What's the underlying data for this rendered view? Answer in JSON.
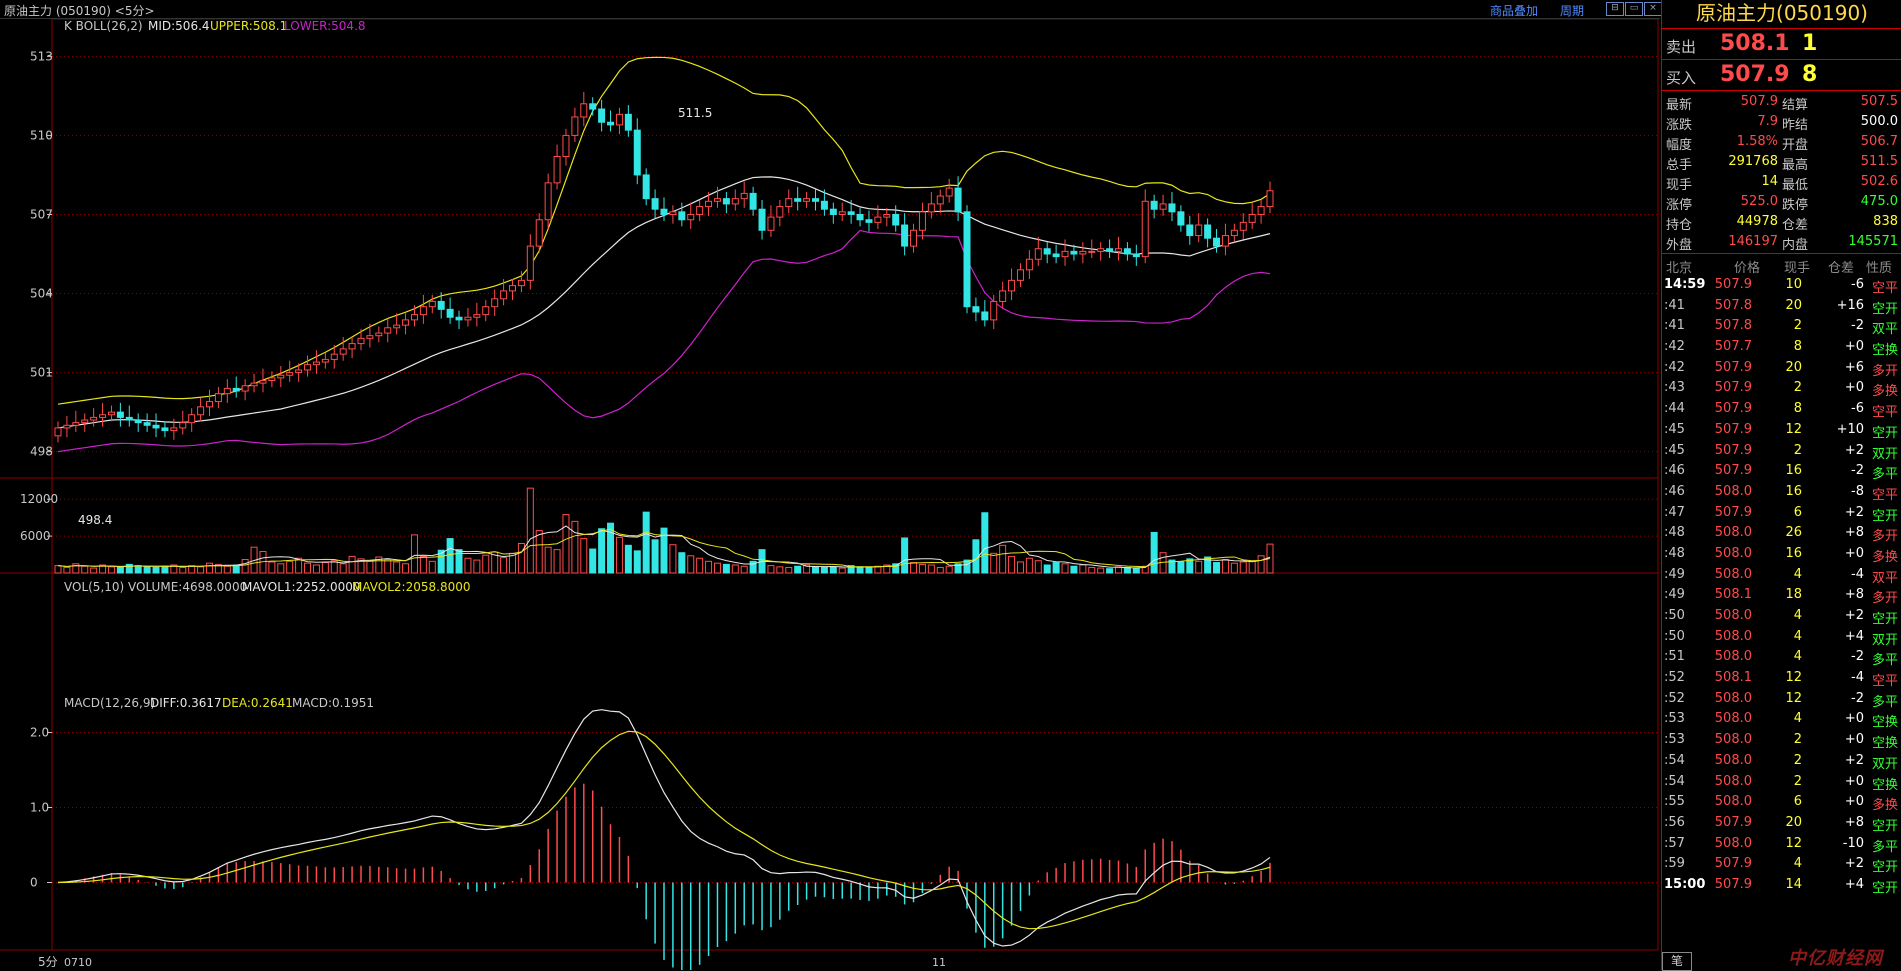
{
  "window": {
    "title": "原油主力 (050190) <5分>",
    "links": [
      "商品叠加",
      "周期"
    ]
  },
  "main_chart": {
    "indicator_label": "K  BOLL(26,2)",
    "mid_label": "MID:506.4",
    "upper_label": "UPPER:508.1",
    "lower_label": "LOWER:504.8",
    "y_ticks": [
      "513",
      "510",
      "507",
      "504",
      "501",
      "498"
    ],
    "high_marker": "511.5",
    "low_marker": "498.4"
  },
  "volume_chart": {
    "vol_label": "VOL(5,10) VOLUME:4698.0000",
    "mavol1_label": "MAVOL1:2252.0000",
    "mavol2_label": "MAVOL2:2058.8000",
    "y_ticks": [
      "12000",
      "6000"
    ]
  },
  "macd_chart": {
    "macd_label": "MACD(12,26,9)",
    "diff_label": "DIFF:0.3617",
    "dea_label": "DEA:0.2641",
    "macd_value_label": "MACD:0.1951",
    "y_ticks": [
      "2.0",
      "1.0",
      "0"
    ]
  },
  "x_axis": {
    "period_label": "5分",
    "labels": [
      "0710",
      "11"
    ]
  },
  "colors": {
    "up": "#ff4b4b",
    "down": "#33e6e6",
    "mid": "#e6e6e6",
    "upper": "#e6e61a",
    "lower": "#cc22cc",
    "grid": "#8b0000"
  },
  "chart_data": [
    {
      "type": "candlestick",
      "title": "",
      "indicators": [
        "BOLL(26,2)"
      ],
      "ylim": [
        497,
        514
      ],
      "x_labels": [
        "0710",
        "11"
      ],
      "open": [
        498.6,
        498.9,
        499.0,
        499.1,
        499.2,
        499.3,
        499.4,
        499.5,
        499.3,
        499.2,
        499.1,
        499.0,
        498.9,
        498.8,
        498.9,
        499.1,
        499.4,
        499.7,
        499.9,
        500.2,
        500.4,
        500.3,
        500.5,
        500.6,
        500.7,
        500.8,
        500.9,
        501.0,
        501.1,
        501.3,
        501.4,
        501.5,
        501.7,
        501.9,
        502.1,
        502.3,
        502.4,
        502.5,
        502.7,
        502.8,
        503.0,
        503.2,
        503.5,
        503.7,
        503.4,
        503.1,
        503.0,
        503.1,
        503.2,
        503.5,
        503.8,
        504.1,
        504.3,
        504.5,
        505.8,
        506.8,
        508.2,
        509.2,
        510.0,
        510.7,
        511.2,
        511.0,
        510.5,
        510.4,
        510.8,
        510.2,
        508.5,
        507.6,
        507.2,
        507.0,
        507.1,
        506.8,
        507.0,
        507.3,
        507.5,
        507.6,
        507.4,
        507.6,
        507.8,
        507.2,
        506.4,
        506.9,
        507.3,
        507.6,
        507.5,
        507.6,
        507.5,
        507.2,
        507.0,
        507.1,
        507.0,
        506.8,
        506.7,
        506.9,
        507.0,
        506.6,
        505.8,
        506.4,
        507.1,
        507.4,
        507.7,
        508.0,
        507.1,
        503.5,
        503.3,
        503.0,
        503.7,
        504.1,
        504.5,
        504.9,
        505.3,
        505.7,
        505.5,
        505.4,
        505.6,
        505.5,
        505.6,
        505.6,
        505.7,
        505.6,
        505.7,
        505.5,
        505.4,
        507.5,
        507.2,
        507.4,
        507.1,
        506.6,
        506.2,
        506.6,
        506.1,
        505.8,
        506.2,
        506.4,
        506.7,
        507.0,
        507.3
      ],
      "close": [
        498.9,
        499.0,
        499.1,
        499.2,
        499.3,
        499.4,
        499.5,
        499.3,
        499.2,
        499.1,
        499.0,
        498.9,
        498.8,
        498.9,
        499.1,
        499.4,
        499.7,
        499.9,
        500.2,
        500.4,
        500.3,
        500.5,
        500.6,
        500.7,
        500.8,
        500.9,
        501.0,
        501.1,
        501.3,
        501.4,
        501.5,
        501.7,
        501.9,
        502.1,
        502.3,
        502.4,
        502.5,
        502.7,
        502.8,
        503.0,
        503.2,
        503.5,
        503.7,
        503.4,
        503.1,
        503.0,
        503.1,
        503.2,
        503.5,
        503.8,
        504.1,
        504.3,
        504.5,
        505.8,
        506.8,
        508.2,
        509.2,
        510.0,
        510.7,
        511.2,
        511.0,
        510.5,
        510.4,
        510.8,
        510.2,
        508.5,
        507.6,
        507.2,
        507.0,
        507.1,
        506.8,
        507.0,
        507.3,
        507.5,
        507.6,
        507.4,
        507.6,
        507.8,
        507.2,
        506.4,
        506.9,
        507.3,
        507.6,
        507.5,
        507.6,
        507.5,
        507.2,
        507.0,
        507.1,
        507.0,
        506.8,
        506.7,
        506.9,
        507.0,
        506.6,
        505.8,
        506.4,
        507.1,
        507.4,
        507.7,
        508.0,
        507.1,
        503.5,
        503.3,
        503.0,
        503.7,
        504.1,
        504.5,
        504.9,
        505.3,
        505.7,
        505.5,
        505.4,
        505.6,
        505.5,
        505.6,
        505.6,
        505.7,
        505.6,
        505.7,
        505.5,
        505.4,
        507.5,
        507.2,
        507.4,
        507.1,
        506.6,
        506.2,
        506.6,
        506.1,
        505.8,
        506.2,
        506.4,
        506.7,
        507.0,
        507.3,
        507.9
      ],
      "boll_mid_start": 499.2,
      "boll_mid_end": 506.4,
      "boll_upper_end": 508.1,
      "boll_lower_end": 504.8
    },
    {
      "type": "bar",
      "title": "",
      "ylim": [
        0,
        13500
      ],
      "volume": [
        1200,
        900,
        1500,
        1100,
        800,
        1300,
        1000,
        900,
        1400,
        1200,
        1000,
        900,
        1100,
        1300,
        900,
        1200,
        1000,
        1600,
        1400,
        1100,
        1300,
        2200,
        4200,
        3500,
        1800,
        1500,
        1900,
        2400,
        1600,
        1300,
        1700,
        2000,
        1500,
        2700,
        2300,
        1900,
        2600,
        2200,
        1800,
        1500,
        6200,
        2700,
        1900,
        3700,
        5600,
        3800,
        2400,
        2100,
        2900,
        3400,
        2500,
        3200,
        4800,
        13800,
        6900,
        4200,
        3800,
        9500,
        8400,
        5600,
        3900,
        7200,
        8100,
        5800,
        4500,
        3600,
        9900,
        5400,
        7300,
        4600,
        3300,
        2800,
        2400,
        1900,
        1600,
        1400,
        1300,
        1100,
        1900,
        3800,
        1200,
        1000,
        900,
        1100,
        1300,
        1000,
        900,
        1000,
        800,
        1200,
        1000,
        900,
        1100,
        1300,
        1500,
        5700,
        1700,
        1400,
        1300,
        900,
        1100,
        1500,
        2100,
        5400,
        9800,
        3200,
        4500,
        2700,
        1800,
        2400,
        2000,
        1300,
        1700,
        1500,
        1100,
        1300,
        900,
        800,
        700,
        1000,
        900,
        800,
        1100,
        6600,
        3300,
        2100,
        1800,
        2300,
        1900,
        2600,
        1700,
        2200,
        1600,
        1800,
        1900,
        2800,
        4698
      ],
      "mavol1_end": 2252,
      "mavol2_end": 2058.8
    },
    {
      "type": "bar",
      "title": "",
      "ylim": [
        -0.9,
        2.3
      ],
      "diff_end": 0.3617,
      "dea_end": 0.2641,
      "macd_end": 0.1951
    }
  ],
  "panel": {
    "title": "原油主力(050190)",
    "sell": {
      "label": "卖出",
      "price": "508.1",
      "vol": "1"
    },
    "buy": {
      "label": "买入",
      "price": "507.9",
      "vol": "8"
    },
    "stats": [
      {
        "k1": "最新",
        "v1": "507.9",
        "c1": "#ff4b4b",
        "k2": "结算",
        "v2": "507.5",
        "c2": "#ff4b4b"
      },
      {
        "k1": "涨跌",
        "v1": "7.9",
        "c1": "#ff4b4b",
        "k2": "昨结",
        "v2": "500.0",
        "c2": "#ffffff"
      },
      {
        "k1": "幅度",
        "v1": "1.58%",
        "c1": "#ff4b4b",
        "k2": "开盘",
        "v2": "506.7",
        "c2": "#ff4b4b"
      },
      {
        "k1": "总手",
        "v1": "291768",
        "c1": "#ffff33",
        "k2": "最高",
        "v2": "511.5",
        "c2": "#ff4b4b"
      },
      {
        "k1": "现手",
        "v1": "14",
        "c1": "#ffff33",
        "k2": "最低",
        "v2": "502.6",
        "c2": "#ff4b4b"
      },
      {
        "k1": "涨停",
        "v1": "525.0",
        "c1": "#ff4b4b",
        "k2": "跌停",
        "v2": "475.0",
        "c2": "#33ff33"
      },
      {
        "k1": "持仓",
        "v1": "44978",
        "c1": "#ffff33",
        "k2": "仓差",
        "v2": "838",
        "c2": "#ffff33"
      },
      {
        "k1": "外盘",
        "v1": "146197",
        "c1": "#ff4b4b",
        "k2": "内盘",
        "v2": "145571",
        "c2": "#33ff33"
      }
    ],
    "tick_header": [
      "北京",
      "价格",
      "现手",
      "仓差",
      "性质"
    ],
    "ticks": [
      {
        "t": "14:59",
        "p": "507.9",
        "v": "10",
        "c": "-6",
        "n": "空平",
        "nc": "#ff4b4b"
      },
      {
        "t": ":41",
        "p": "507.8",
        "v": "20",
        "c": "+16",
        "n": "空开",
        "nc": "#33ff33"
      },
      {
        "t": ":41",
        "p": "507.8",
        "v": "2",
        "c": "-2",
        "n": "双平",
        "nc": "#33ff33"
      },
      {
        "t": ":42",
        "p": "507.7",
        "v": "8",
        "c": "+0",
        "n": "空换",
        "nc": "#33ff33"
      },
      {
        "t": ":42",
        "p": "507.9",
        "v": "20",
        "c": "+6",
        "n": "多开",
        "nc": "#ff4b4b"
      },
      {
        "t": ":43",
        "p": "507.9",
        "v": "2",
        "c": "+0",
        "n": "多换",
        "nc": "#ff4b4b"
      },
      {
        "t": ":44",
        "p": "507.9",
        "v": "8",
        "c": "-6",
        "n": "空平",
        "nc": "#ff4b4b"
      },
      {
        "t": ":45",
        "p": "507.9",
        "v": "12",
        "c": "+10",
        "n": "空开",
        "nc": "#33ff33"
      },
      {
        "t": ":45",
        "p": "507.9",
        "v": "2",
        "c": "+2",
        "n": "双开",
        "nc": "#33ff33"
      },
      {
        "t": ":46",
        "p": "507.9",
        "v": "16",
        "c": "-2",
        "n": "多平",
        "nc": "#33ff33"
      },
      {
        "t": ":46",
        "p": "508.0",
        "v": "16",
        "c": "-8",
        "n": "空平",
        "nc": "#ff4b4b"
      },
      {
        "t": ":47",
        "p": "507.9",
        "v": "6",
        "c": "+2",
        "n": "空开",
        "nc": "#33ff33"
      },
      {
        "t": ":48",
        "p": "508.0",
        "v": "26",
        "c": "+8",
        "n": "多开",
        "nc": "#ff4b4b"
      },
      {
        "t": ":48",
        "p": "508.0",
        "v": "16",
        "c": "+0",
        "n": "多换",
        "nc": "#ff4b4b"
      },
      {
        "t": ":49",
        "p": "508.0",
        "v": "4",
        "c": "-4",
        "n": "双平",
        "nc": "#ff4b4b"
      },
      {
        "t": ":49",
        "p": "508.1",
        "v": "18",
        "c": "+8",
        "n": "多开",
        "nc": "#ff4b4b"
      },
      {
        "t": ":50",
        "p": "508.0",
        "v": "4",
        "c": "+2",
        "n": "空开",
        "nc": "#33ff33"
      },
      {
        "t": ":50",
        "p": "508.0",
        "v": "4",
        "c": "+4",
        "n": "双开",
        "nc": "#33ff33"
      },
      {
        "t": ":51",
        "p": "508.0",
        "v": "4",
        "c": "-2",
        "n": "多平",
        "nc": "#33ff33"
      },
      {
        "t": ":52",
        "p": "508.1",
        "v": "12",
        "c": "-4",
        "n": "空平",
        "nc": "#ff4b4b"
      },
      {
        "t": ":52",
        "p": "508.0",
        "v": "12",
        "c": "-2",
        "n": "多平",
        "nc": "#33ff33"
      },
      {
        "t": ":53",
        "p": "508.0",
        "v": "4",
        "c": "+0",
        "n": "空换",
        "nc": "#33ff33"
      },
      {
        "t": ":53",
        "p": "508.0",
        "v": "2",
        "c": "+0",
        "n": "空换",
        "nc": "#33ff33"
      },
      {
        "t": ":54",
        "p": "508.0",
        "v": "2",
        "c": "+2",
        "n": "双开",
        "nc": "#33ff33"
      },
      {
        "t": ":54",
        "p": "508.0",
        "v": "2",
        "c": "+0",
        "n": "空换",
        "nc": "#33ff33"
      },
      {
        "t": ":55",
        "p": "508.0",
        "v": "6",
        "c": "+0",
        "n": "多换",
        "nc": "#ff4b4b"
      },
      {
        "t": ":56",
        "p": "507.9",
        "v": "20",
        "c": "+8",
        "n": "空开",
        "nc": "#33ff33"
      },
      {
        "t": ":57",
        "p": "508.0",
        "v": "12",
        "c": "-10",
        "n": "多平",
        "nc": "#33ff33"
      },
      {
        "t": ":59",
        "p": "507.9",
        "v": "4",
        "c": "+2",
        "n": "空开",
        "nc": "#33ff33"
      },
      {
        "t": "15:00",
        "p": "507.9",
        "v": "14",
        "c": "+4",
        "n": "空开",
        "nc": "#33ff33"
      }
    ],
    "bottom_tab": "笔",
    "watermark": "中亿财经网"
  }
}
